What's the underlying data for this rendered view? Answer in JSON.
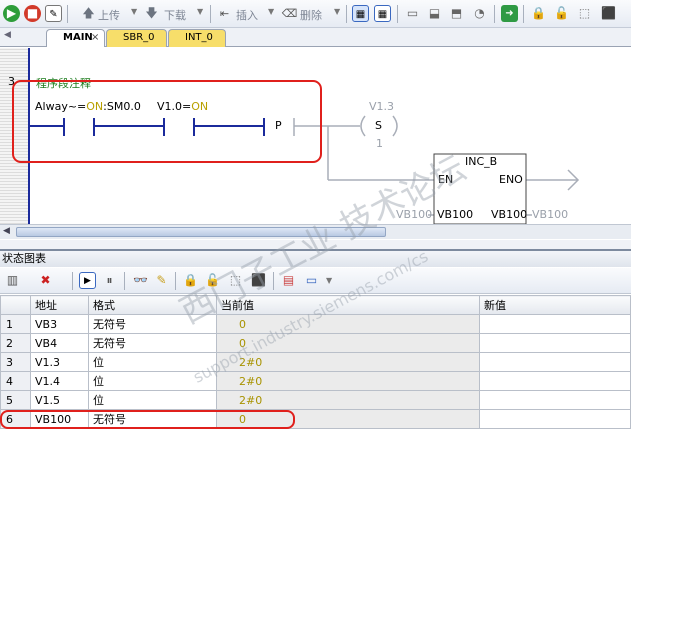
{
  "toolbar": {
    "upload_label": "上传",
    "download_label": "下载",
    "insert_label": "插入",
    "delete_label": "删除"
  },
  "tabs": [
    {
      "label": "MAIN",
      "close": "×"
    },
    {
      "label": "SBR_0"
    },
    {
      "label": "INT_0"
    }
  ],
  "network": {
    "number": "3",
    "comment": "程序段注释",
    "contact1": {
      "prefix": "Alway~=",
      "state": "ON",
      "address": ":SM0.0"
    },
    "contact2": {
      "address": "V1.0=",
      "state": "ON"
    },
    "pulse_label": "P",
    "coil": {
      "address": "V1.3",
      "type": "S",
      "count": "1"
    },
    "box": {
      "name": "INC_B",
      "en": "EN",
      "eno": "ENO",
      "in_param": "VB100",
      "out_param": "VB100",
      "in_value": "VB100",
      "out_value": "VB100"
    }
  },
  "status_chart": {
    "title": "状态图表",
    "columns": [
      "",
      "地址",
      "格式",
      "当前值",
      "新值"
    ],
    "rows": [
      {
        "n": "1",
        "address": "VB3",
        "format": "无符号",
        "value": "0"
      },
      {
        "n": "2",
        "address": "VB4",
        "format": "无符号",
        "value": "0"
      },
      {
        "n": "3",
        "address": "V1.3",
        "format": "位",
        "value": "2#0"
      },
      {
        "n": "4",
        "address": "V1.4",
        "format": "位",
        "value": "2#0"
      },
      {
        "n": "5",
        "address": "V1.5",
        "format": "位",
        "value": "2#0"
      },
      {
        "n": "6",
        "address": "VB100",
        "format": "无符号",
        "value": "0"
      }
    ]
  },
  "watermark": {
    "line1": "西门子工业  技术论坛",
    "line2": "support.industry.siemens.com/cs"
  },
  "colors": {
    "highlight": "#e0201c",
    "wire": "#1b2a9b",
    "on_state": "#b8a000"
  }
}
